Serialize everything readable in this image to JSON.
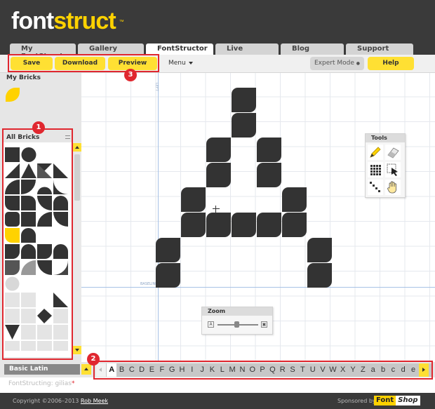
{
  "logo": {
    "part1": "font",
    "part2": "struct",
    "tm": "™"
  },
  "tabs": [
    {
      "label": "My FontStruct"
    },
    {
      "label": "Gallery"
    },
    {
      "label": "FontStructor"
    },
    {
      "label": "Live"
    },
    {
      "label": "Blog"
    },
    {
      "label": "Support"
    }
  ],
  "toolbar": {
    "save": "Save",
    "download": "Download",
    "preview": "Preview",
    "menu": "Menu",
    "expert_mode": "Expert Mode",
    "expert_dot": "●",
    "help": "Help"
  },
  "left_panel": {
    "my_bricks": "My Bricks",
    "all_bricks": "All Bricks"
  },
  "canvas": {
    "baseline_label": "BASELINE",
    "left_label": "LEFT"
  },
  "tools": {
    "title": "Tools",
    "items": [
      "pencil-icon",
      "eraser-icon",
      "grid-icon",
      "select-arrow-icon",
      "line-icon",
      "hand-icon"
    ]
  },
  "zoom": {
    "title": "Zoom",
    "min_icon": "A",
    "max_icon": "▣"
  },
  "charset": {
    "label": "Basic Latin"
  },
  "characters": [
    "A",
    "B",
    "C",
    "D",
    "E",
    "F",
    "G",
    "H",
    "I",
    "J",
    "K",
    "L",
    "M",
    "N",
    "O",
    "P",
    "Q",
    "R",
    "S",
    "T",
    "U",
    "V",
    "W",
    "X",
    "Y",
    "Z",
    "a",
    "b",
    "c",
    "d",
    "e"
  ],
  "selected_character": "A",
  "status": {
    "text": "FontStructing: gilias",
    "required_mark": "*"
  },
  "footer": {
    "copyright": "Copyright ©2006–2013",
    "author": "Rob Meek",
    "sponsored_by": "Sponsored by",
    "sponsor_a": "Font",
    "sponsor_b": "Shop"
  },
  "annotations": [
    "1",
    "2",
    "3"
  ],
  "colors": {
    "accent": "#ffd200",
    "header": "#3a3a3a",
    "highlight": "#e0272f",
    "glyph": "#333333"
  }
}
